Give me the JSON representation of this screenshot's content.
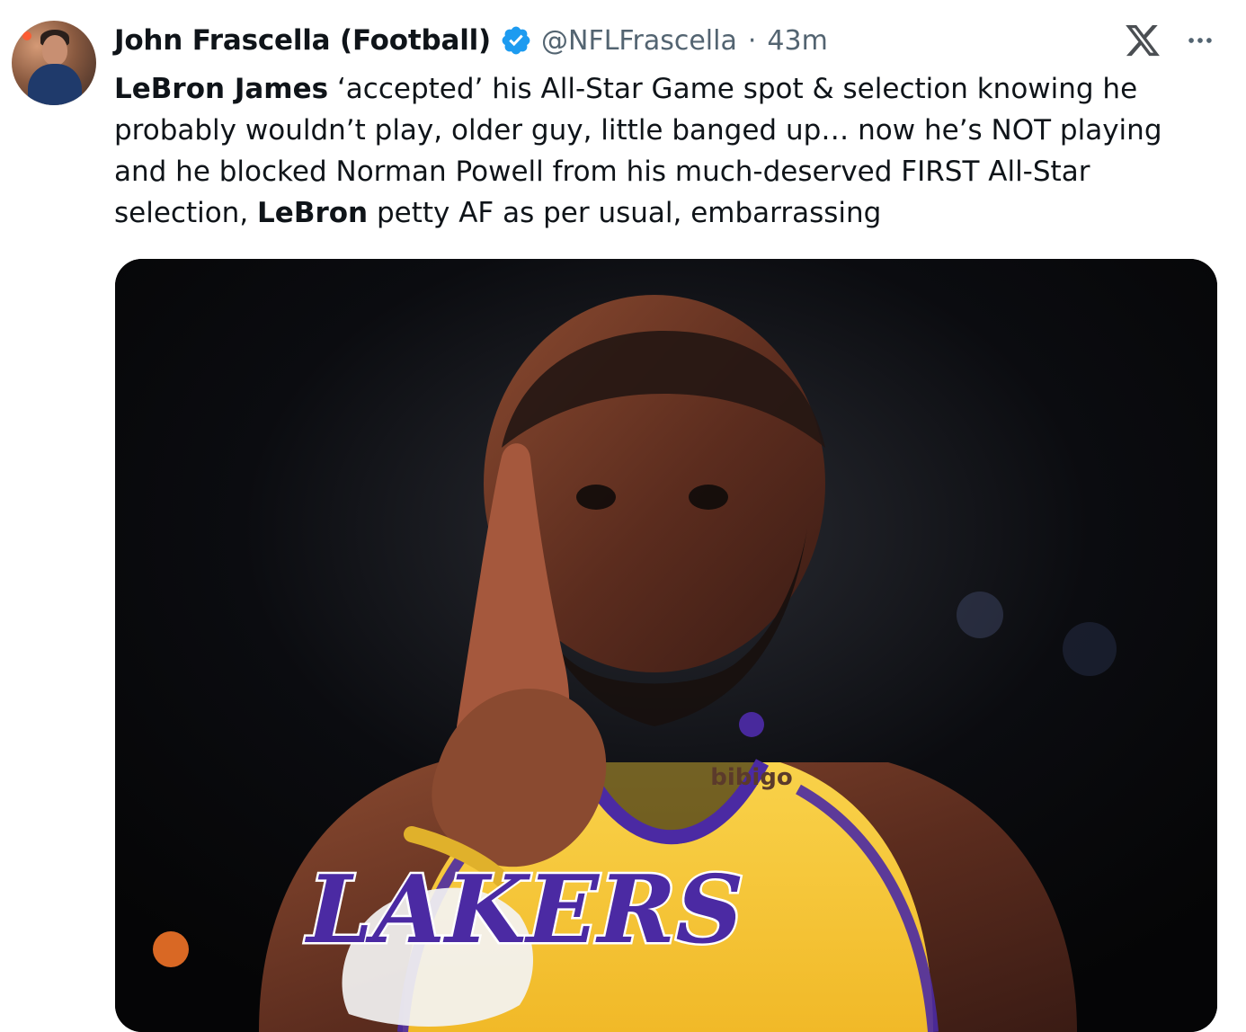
{
  "tweet": {
    "author": {
      "display_name": "John Frascella (Football)",
      "handle": "@NFLFrascella",
      "verified": true,
      "avatar_icon": "profile-avatar"
    },
    "separator": "·",
    "timestamp": "43m",
    "top_right_icons": [
      "x-logo-icon",
      "more-options-icon"
    ],
    "body": {
      "lines": [
        [
          {
            "t": "LeBron James",
            "b": true
          },
          {
            "t": " ‘accepted’ his All-Star Game spot & selection knowing he",
            "b": false
          }
        ],
        [
          {
            "t": "probably wouldn’t play, older guy, little banged up… now he’s NOT playing",
            "b": false
          }
        ],
        [
          {
            "t": "and he blocked Norman Powell from his much-deserved FIRST All-Star",
            "b": false
          }
        ],
        [
          {
            "t": "selection, ",
            "b": false
          },
          {
            "t": "LeBron",
            "b": true
          },
          {
            "t": " petty AF as per usual, embarrassing",
            "b": false
          }
        ]
      ]
    },
    "media": {
      "jersey_sponsor": "bibigo",
      "jersey_wordmark": "LAKERS"
    }
  },
  "colors": {
    "text": "#0f1419",
    "secondary": "#536471",
    "verified": "#1d9bf0",
    "media_bg": "#050506",
    "jersey": "#f7c93b",
    "jersey_trim": "#4b2aa3"
  }
}
